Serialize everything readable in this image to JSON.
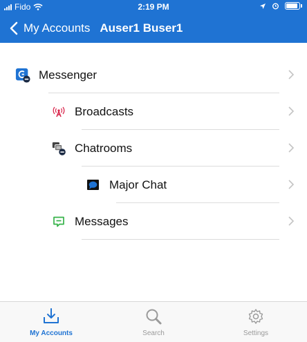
{
  "status_bar": {
    "carrier": "Fido",
    "time": "2:19 PM"
  },
  "nav": {
    "back_label": "My Accounts",
    "title": "Auser1 Buser1"
  },
  "list": [
    {
      "label": "Messenger",
      "icon": "messenger-icon"
    },
    {
      "label": "Broadcasts",
      "icon": "broadcast-antenna-icon"
    },
    {
      "label": "Chatrooms",
      "icon": "chatrooms-icon"
    },
    {
      "label": "Major Chat",
      "icon": "chat-bubble-icon"
    },
    {
      "label": "Messages",
      "icon": "message-icon"
    }
  ],
  "tabbar": {
    "tabs": [
      {
        "label": "My Accounts",
        "icon": "download-tray-icon",
        "active": true
      },
      {
        "label": "Search",
        "icon": "search-icon",
        "active": false
      },
      {
        "label": "Settings",
        "icon": "gear-icon",
        "active": false
      }
    ]
  },
  "colors": {
    "accent": "#1f73d3",
    "broadcast": "#d9254b",
    "messages": "#36b34a"
  }
}
